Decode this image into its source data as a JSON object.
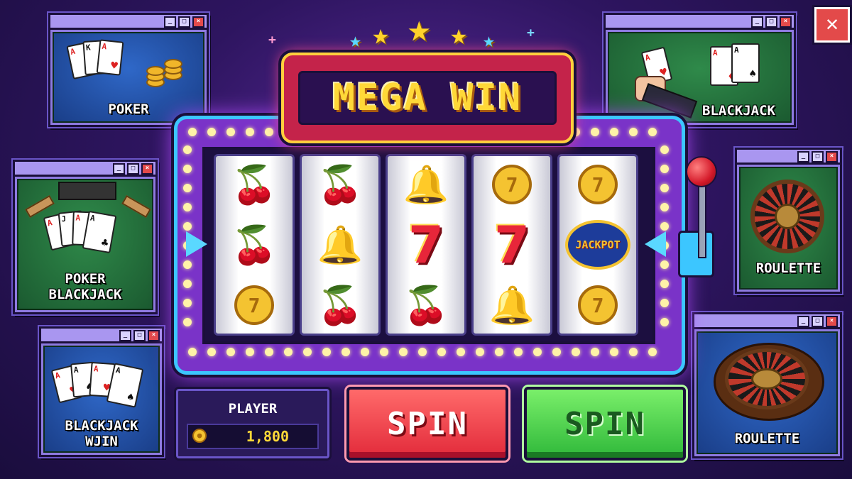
{
  "marquee": {
    "title": "MEGA WIN"
  },
  "windows": {
    "poker": {
      "label": "POKER"
    },
    "poker_blackjack": {
      "label_line1": "POKER",
      "label_line2": "BLACKJACK"
    },
    "blackjack_win": {
      "label_line1": "BLACKJACK",
      "label_line2": "WJIN"
    },
    "blackjack": {
      "label": "BLACKJACK"
    },
    "roulette_top": {
      "label": "ROULETTE"
    },
    "roulette_bottom": {
      "label": "ROULETTE"
    }
  },
  "reels": [
    [
      "cherry",
      "cherry",
      "coin-7"
    ],
    [
      "cherry",
      "bell",
      "cherry"
    ],
    [
      "bell",
      "seven",
      "cherry"
    ],
    [
      "coin-7",
      "seven",
      "bell"
    ],
    [
      "coin-7",
      "jackpot",
      "coin-7"
    ]
  ],
  "symbols": {
    "seven": "7",
    "coin_seven": "7",
    "jackpot": "JACKPOT"
  },
  "player": {
    "label": "PLAYER",
    "balance": "1,800"
  },
  "buttons": {
    "spin_red": "SPIN",
    "spin_green": "SPIN",
    "close": "✕"
  },
  "colors": {
    "accent": "#3cc6ff",
    "cabinet": "#7a33c8",
    "marquee": "#c4234a",
    "gold": "#ffd838"
  }
}
